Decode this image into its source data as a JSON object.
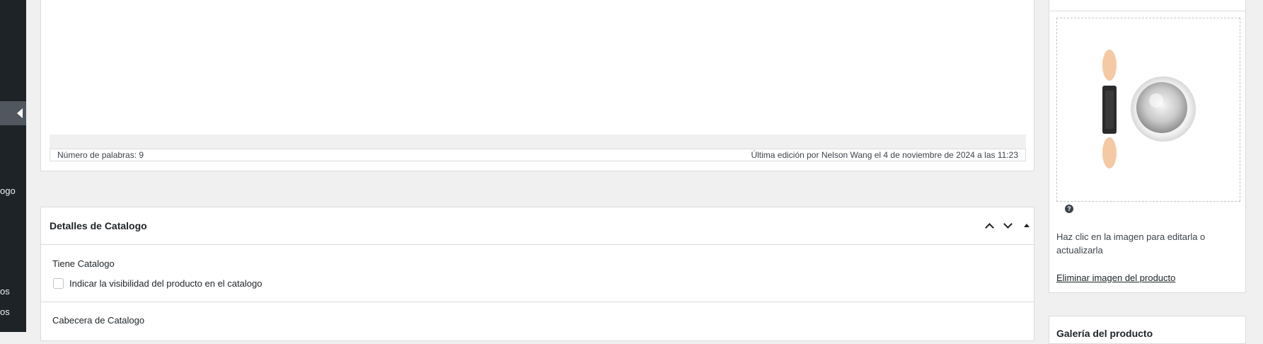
{
  "sidebar": {
    "fragments": [
      "ogo",
      "os",
      "os"
    ]
  },
  "editor": {
    "word_count": "Número de palabras: 9",
    "last_edit": "Última edición por Nelson Wang el 4 de noviembre de 2024 a las 11:23"
  },
  "catalog_box": {
    "title": "Detalles de Catalogo",
    "controls": [
      "chevron-up-icon",
      "chevron-down-icon",
      "toggle-triangle-icon"
    ],
    "has_catalog_label": "Tiene Catalogo",
    "visibility_checkbox_label": "Indicar la visibilidad del producto en el catalogo",
    "visibility_checked": false,
    "header_label": "Cabecera de Catalogo"
  },
  "product_image_panel": {
    "help_glyph": "?",
    "hint": "Haz clic en la imagen para editarla o actualizarla",
    "remove_link": "Eliminar imagen del producto"
  },
  "next_panel": {
    "title": "Galería del producto"
  },
  "colors": {
    "sidebar": "#1d2327",
    "sidebar_active": "#50575e",
    "background": "#f0f0f1",
    "border": "#dcdcde"
  }
}
